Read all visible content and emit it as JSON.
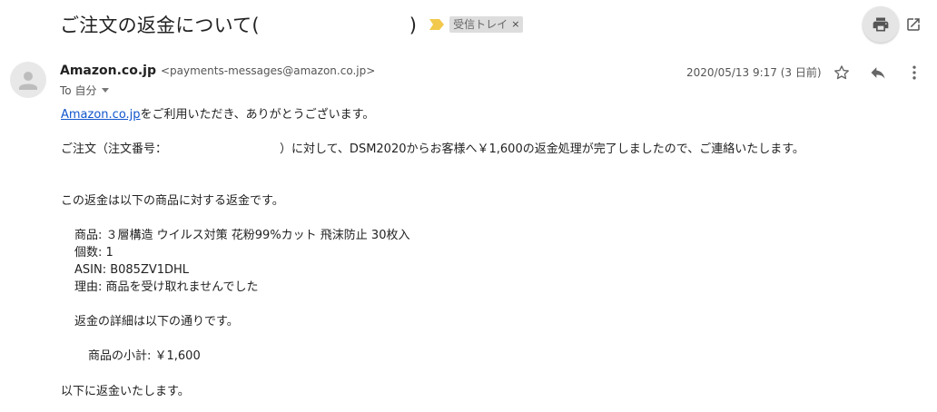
{
  "subject": {
    "title": "ご注文の返金について(                        )",
    "label": "受信トレイ",
    "label_remove": "×"
  },
  "toolbar": {
    "print_icon": "printer-icon",
    "popout_icon": "open-in-new-window-icon"
  },
  "message": {
    "sender_name": "Amazon.co.jp",
    "sender_email": "<payments-messages@amazon.co.jp>",
    "to_label": "To 自分",
    "date": "2020/05/13 9:17 (3 日前)",
    "star_icon": "star-icon",
    "reply_icon": "reply-icon",
    "more_icon": "more-vert-icon"
  },
  "body": {
    "greeting_link": "Amazon.co.jp",
    "greeting_rest": "をご利用いただき、ありがとうございます。",
    "line2": "ご注文（注文番号：                              ）に対して、DSM2020からお客様へ￥1,600の返金処理が完了しましたので、ご連絡いたします。",
    "line3": "この返金は以下の商品に対する返金です。",
    "item_product": "商品: ３層構造 ウイルス対策 花粉99%カット 飛沫防止 30枚入",
    "item_qty": "個数: 1",
    "item_asin": "ASIN: B085ZV1DHL",
    "item_reason": "理由: 商品を受け取れませんでした",
    "detail_intro": "返金の詳細は以下の通りです。",
    "subtotal": "商品の小計: ￥1,600",
    "closing": "以下に返金いたします。"
  },
  "colors": {
    "importance": "#f2c94c",
    "link": "#1155cc",
    "chip": "#dddddd"
  }
}
